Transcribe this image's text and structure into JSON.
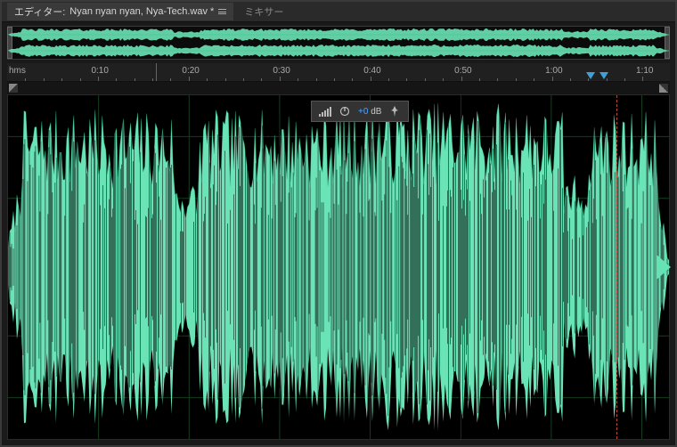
{
  "tabs": {
    "editor_prefix": "エディター:",
    "filename": "Nyan nyan nyan, Nya-Tech.wav *",
    "mixer_label": "ミキサー"
  },
  "ruler": {
    "unit_label": "hms",
    "ticks": [
      "0:10",
      "0:20",
      "0:30",
      "0:40",
      "0:50",
      "1:00",
      "1:10"
    ]
  },
  "hud": {
    "db_value": "+0",
    "db_unit": "dB"
  },
  "playhead_pct": 22.5,
  "time_cursor_pct": 92,
  "markers_pct": [
    88,
    90
  ],
  "colors": {
    "waveform": "#6ae3b7",
    "waveform_edge": "#2fb98a",
    "grid": "#163d20",
    "bg": "#000000"
  }
}
